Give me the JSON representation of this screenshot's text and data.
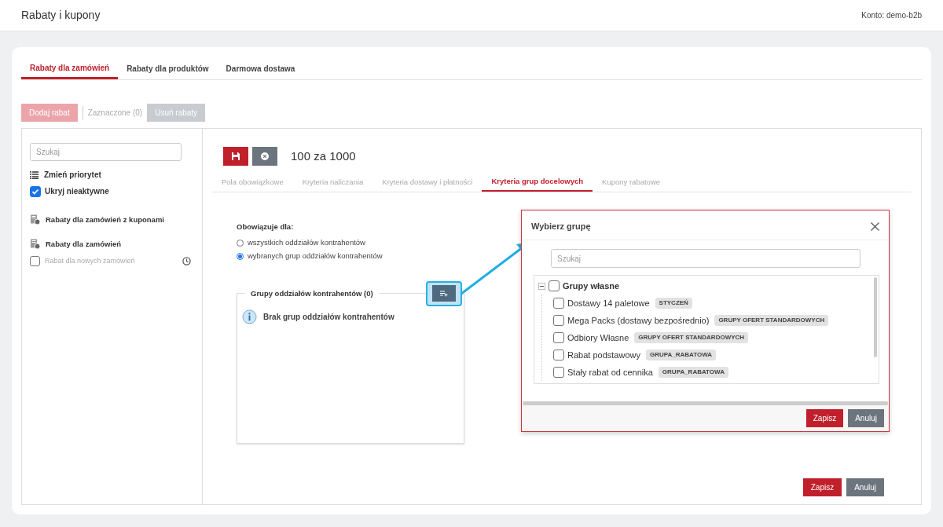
{
  "header": {
    "title": "Rabaty i kupony",
    "account": "Konto: demo-b2b"
  },
  "tabs": [
    {
      "label": "Rabaty dla zamówień",
      "selected": true
    },
    {
      "label": "Rabaty dla produktów",
      "selected": false
    },
    {
      "label": "Darmowa dostawa",
      "selected": false
    }
  ],
  "toolbar": {
    "add_button": {
      "label": "Dodaj rabat",
      "disabled": true
    },
    "selected_count": "Zaznaczone (0)",
    "delete_button": {
      "label": "Usuń rabaty",
      "disabled": true
    }
  },
  "sidebar": {
    "search": {
      "placeholder": "Szukaj"
    },
    "priority_action": "Zmień priorytet",
    "hide_inactive": {
      "label": "Ukryj nieaktywne",
      "checked": true
    },
    "categories": [
      {
        "label": "Rabaty dla zamówień z kuponami"
      },
      {
        "label": "Rabaty dla zamówień",
        "children": [
          {
            "label": "Rabat dla nowych zamówień",
            "checked": false,
            "inactive": true
          }
        ]
      }
    ]
  },
  "editor": {
    "title": "100 za 1000",
    "subtabs": [
      {
        "label": "Pola obowiązkowe",
        "selected": false
      },
      {
        "label": "Kryteria naliczania",
        "selected": false
      },
      {
        "label": "Kryteria dostawy i płatności",
        "selected": false
      },
      {
        "label": "Kryteria grup docelowych",
        "selected": true
      },
      {
        "label": "Kupony rabatowe",
        "selected": false
      }
    ],
    "applies_to": {
      "label": "Obowiązuje dla:",
      "options": [
        {
          "label": "wszystkich oddziałów kontrahentów",
          "selected": false
        },
        {
          "label": "wybranych grup oddziałów kontrahentów",
          "selected": true
        }
      ]
    },
    "groups": {
      "legend": "Grupy oddziałów kontrahentów (0)",
      "empty_message": "Brak grup oddziałów kontrahentów"
    },
    "save_button": "Zapisz",
    "cancel_button": "Anuluj"
  },
  "dialog": {
    "title": "Wybierz grupę",
    "search": {
      "placeholder": "Szukaj"
    },
    "tree": [
      {
        "label": "Grupy własne",
        "checked": false,
        "expanded": true,
        "children": [
          {
            "label": "Dostawy 14 paletowe",
            "checked": false,
            "tag": "STYCZEŃ"
          },
          {
            "label": "Mega Packs (dostawy bezpośrednio)",
            "checked": false,
            "tag": "GRUPY OFERT STANDARDOWYCH"
          },
          {
            "label": "Odbiory Własne",
            "checked": false,
            "tag": "GRUPY OFERT STANDARDOWYCH"
          },
          {
            "label": "Rabat podstawowy",
            "checked": false,
            "tag": "GRUPA_RABATOWA"
          },
          {
            "label": "Stały rabat od cennika",
            "checked": false,
            "tag": "GRUPA_RABATOWA"
          }
        ]
      }
    ],
    "save_button": "Zapisz",
    "cancel_button": "Anuluj"
  }
}
